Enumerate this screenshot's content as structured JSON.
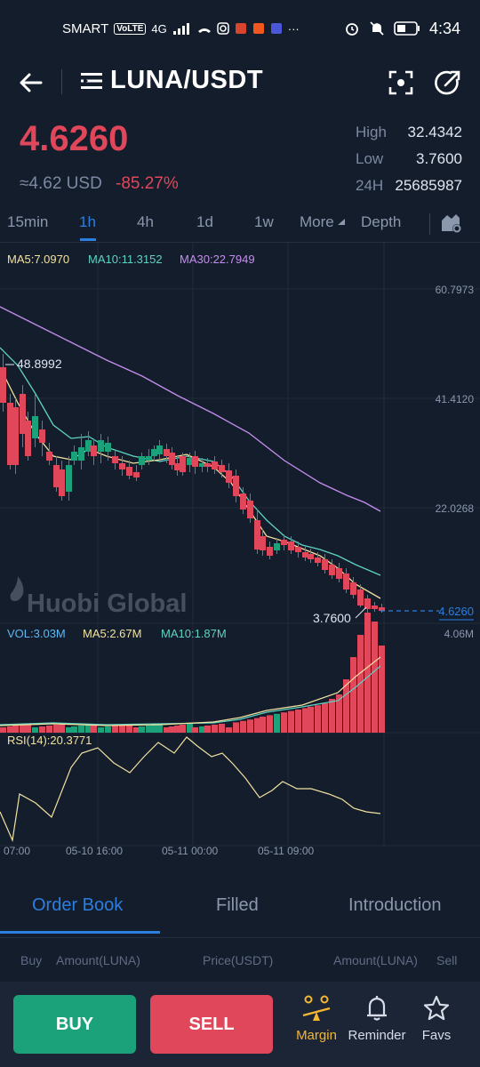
{
  "status_bar": {
    "carrier": "SMART",
    "volte": "VoLTE",
    "network": "4G",
    "time": "4:34"
  },
  "header": {
    "pair": "LUNA/USDT",
    "icons": [
      "back-arrow-icon",
      "list-menu-icon",
      "scan-icon",
      "share-icon"
    ]
  },
  "ticker": {
    "price": "4.6260",
    "usd_approx": "≈4.62 USD",
    "change": "-85.27%",
    "high_label": "High",
    "high": "32.4342",
    "low_label": "Low",
    "low": "3.7600",
    "vol_label": "24H",
    "vol": "25685987"
  },
  "tabs": [
    {
      "label": "15min"
    },
    {
      "label": "1h"
    },
    {
      "label": "4h"
    },
    {
      "label": "1d"
    },
    {
      "label": "1w"
    },
    {
      "label": "More"
    },
    {
      "label": "Depth"
    }
  ],
  "chart": {
    "ma5": "MA5:7.0970",
    "ma10": "MA10:11.3152",
    "ma30": "MA30:22.7949",
    "axis_labels": [
      "60.7973",
      "41.4120",
      "22.0268"
    ],
    "high_marker": "48.8992",
    "low_marker": "3.7600",
    "last_price": "4.6260",
    "watermark": "Huobi Global",
    "vol_label": "VOL:3.03M",
    "vol_ma5": "MA5:2.67M",
    "vol_ma10": "MA10:1.87M",
    "vol_max": "4.06M",
    "rsi_label": "RSI(14):20.3771",
    "time_labels": [
      "07:00",
      "05-10 16:00",
      "05-11 00:00",
      "05-11 09:00"
    ],
    "colors": {
      "up": "#1ba27a",
      "down": "#e0475b",
      "ma5": "#f2e2a0",
      "ma10": "#5ed3c3",
      "ma30": "#c58ef0",
      "rsi": "#f2e2a0"
    }
  },
  "bottom_tabs": [
    {
      "label": "Order Book"
    },
    {
      "label": "Filled"
    },
    {
      "label": "Introduction"
    }
  ],
  "order_book_header": {
    "buy": "Buy",
    "amount_left": "Amount(LUNA)",
    "price": "Price(USDT)",
    "amount_right": "Amount(LUNA)",
    "sell": "Sell"
  },
  "actions": {
    "buy": "BUY",
    "sell": "SELL",
    "margin": "Margin",
    "reminder": "Reminder",
    "favs": "Favs"
  }
}
